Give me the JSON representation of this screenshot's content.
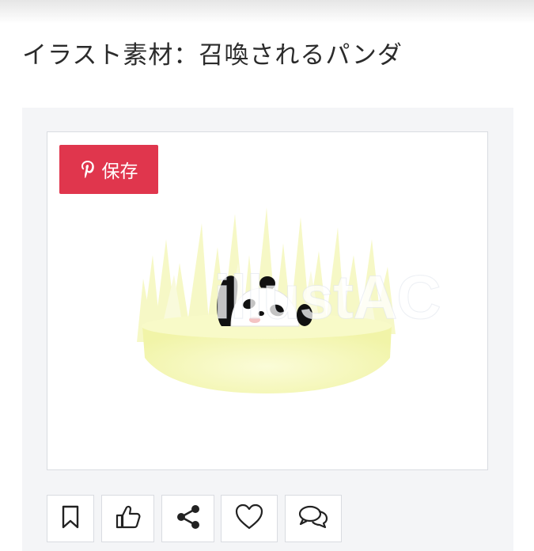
{
  "page": {
    "title": "イラスト素材：召喚されるパンダ"
  },
  "image_card": {
    "pinterest_save_label": "保存",
    "pinterest_color": "#e0364d",
    "watermark_text": "illustAC",
    "illustration_icon": "panda-in-grass"
  },
  "actions": [
    {
      "icon": "bookmark-icon"
    },
    {
      "icon": "thumbs-up-icon"
    },
    {
      "icon": "share-icon"
    },
    {
      "icon": "heart-icon"
    },
    {
      "icon": "comments-icon"
    }
  ]
}
